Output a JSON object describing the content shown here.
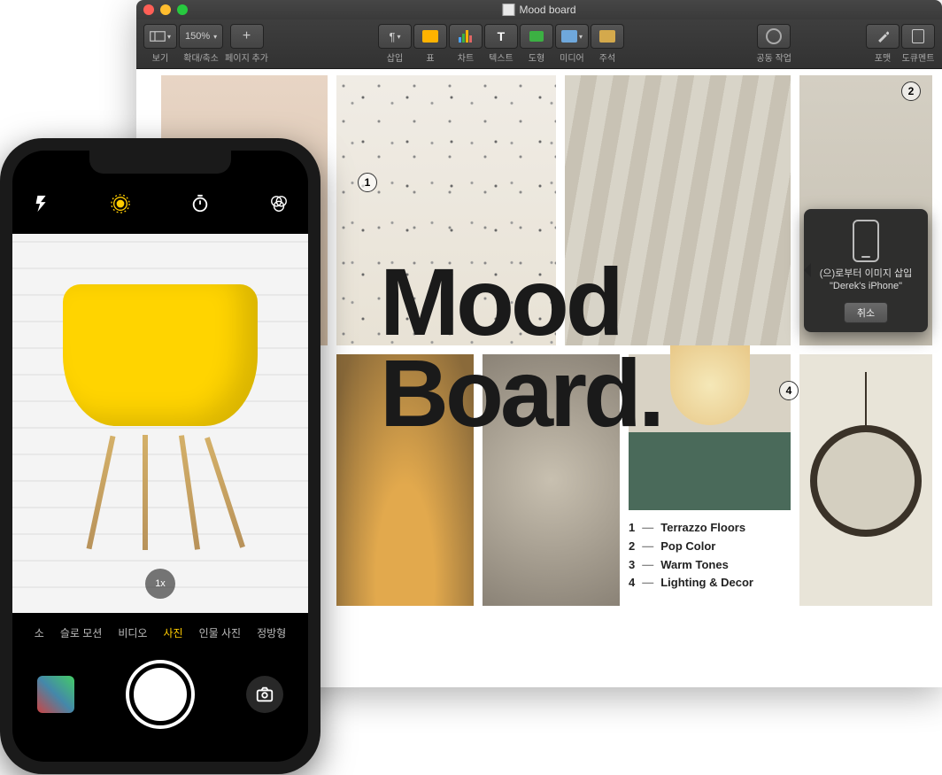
{
  "window": {
    "title": "Mood board",
    "toolbar": {
      "view": "보기",
      "zoom_value": "150%",
      "zoom": "확대/축소",
      "add_page": "페이지 추가",
      "insert": "삽입",
      "table": "표",
      "chart": "차트",
      "text": "텍스트",
      "shape": "도형",
      "media": "미디어",
      "annotation": "주석",
      "collab": "공동 작업",
      "format": "포맷",
      "document": "도큐멘트"
    }
  },
  "document": {
    "headline_line1": "Mood",
    "headline_line2": "Board.",
    "callouts": {
      "c1": "1",
      "c2": "2",
      "c4": "4"
    },
    "legend": [
      {
        "num": "1",
        "label": "Terrazzo Floors"
      },
      {
        "num": "2",
        "label": "Pop Color"
      },
      {
        "num": "3",
        "label": "Warm Tones"
      },
      {
        "num": "4",
        "label": "Lighting & Decor"
      }
    ]
  },
  "popover": {
    "line1": "(으)로부터 이미지 삽입",
    "line2": "\"Derek's iPhone\"",
    "cancel": "취소"
  },
  "iphone": {
    "modes": {
      "m0": "소",
      "slomo": "슬로 모션",
      "video": "비디오",
      "photo": "사진",
      "portrait": "인물 사진",
      "square": "정방형"
    },
    "zoom": "1x"
  }
}
